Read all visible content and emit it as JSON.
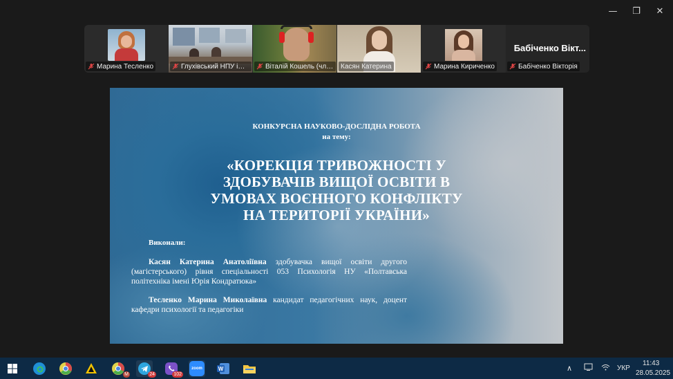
{
  "window_controls": {
    "minimize": "—",
    "restore": "❐",
    "close": "✕"
  },
  "participants": [
    {
      "name": "Марина Тесленко",
      "muted": true,
      "video": "portrait"
    },
    {
      "name": "Глухівський НПУ ім. Д...",
      "muted": true,
      "video": "room"
    },
    {
      "name": "Віталій Кошель (член...",
      "muted": true,
      "video": "headset"
    },
    {
      "name": "Касян Катерина",
      "muted": false,
      "video": "speaker",
      "active": true
    },
    {
      "name": "Марина Кириченко",
      "muted": true,
      "video": "portrait2"
    },
    {
      "name": "Бабіченко Вікторія",
      "muted": true,
      "video": "none",
      "display_name": "Бабіченко Вікт..."
    }
  ],
  "slide": {
    "heading_line1": "КОНКУРСНА НАУКОВО-ДОСЛІДНА РОБОТА",
    "heading_line2": "на тему:",
    "title_line1": "«КОРЕКЦІЯ ТРИВОЖНОСТІ У",
    "title_line2": "ЗДОБУВАЧІВ ВИЩОЇ ОСВІТИ В",
    "title_line3": "УМОВАХ ВОЄННОГО КОНФЛІКТУ",
    "title_line4": "НА ТЕРИТОРІЇ УКРАЇНИ»",
    "performed_by_label": "Виконали:",
    "author1_name": "Касян Катерина Анатоліївна",
    "author1_desc": " здобувачка вищої освіти другого (магістерського) рівня спеціальності 053 Психологія НУ «Полтавська політехніка імені Юрія Кондратюка»",
    "author2_name": "Тесленко Марина Миколаївна",
    "author2_desc": " кандидат педагогічних наук, доцент кафедри психології та педагогіки"
  },
  "taskbar": {
    "apps": [
      {
        "name": "windows-start",
        "badge": ""
      },
      {
        "name": "edge",
        "badge": ""
      },
      {
        "name": "chrome-alt",
        "badge": ""
      },
      {
        "name": "norton",
        "badge": ""
      },
      {
        "name": "chrome",
        "badge": ""
      },
      {
        "name": "telegram",
        "badge": "24"
      },
      {
        "name": "viber",
        "badge": "102"
      },
      {
        "name": "zoom",
        "badge": ""
      },
      {
        "name": "word",
        "badge": ""
      },
      {
        "name": "explorer",
        "badge": ""
      }
    ],
    "zoom_label": "zoom",
    "language": "УКР",
    "time": "11:43",
    "date": "28.05.2025"
  }
}
